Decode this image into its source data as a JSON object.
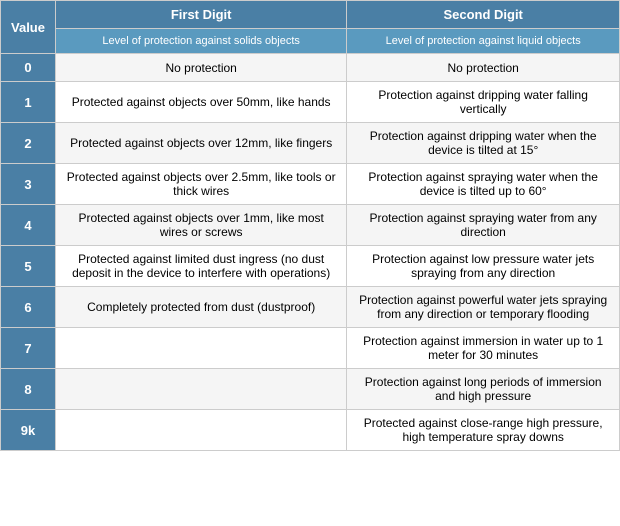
{
  "table": {
    "col1_header": "First Digit",
    "col2_header": "Second Digit",
    "col1_sub": "Level of protection against solids objects",
    "col2_sub": "Level of protection against liquid objects",
    "value_label": "Value",
    "rows": [
      {
        "value": "0",
        "solid": "No protection",
        "liquid": "No protection"
      },
      {
        "value": "1",
        "solid": "Protected against objects over 50mm, like hands",
        "liquid": "Protection against dripping water falling vertically"
      },
      {
        "value": "2",
        "solid": "Protected against objects over 12mm, like fingers",
        "liquid": "Protection against dripping water when the device is tilted at 15°"
      },
      {
        "value": "3",
        "solid": "Protected against objects over 2.5mm, like tools or thick wires",
        "liquid": "Protection against spraying water when the device is tilted up to 60°"
      },
      {
        "value": "4",
        "solid": "Protected against objects over 1mm, like most wires or screws",
        "liquid": "Protection against spraying water from any direction"
      },
      {
        "value": "5",
        "solid": "Protected against limited dust ingress (no dust deposit in the device to interfere with operations)",
        "liquid": "Protection against low pressure water jets spraying from any direction"
      },
      {
        "value": "6",
        "solid": "Completely protected from dust (dustproof)",
        "liquid": "Protection against powerful water jets spraying from any direction or temporary flooding"
      },
      {
        "value": "7",
        "solid": "",
        "liquid": "Protection against immersion in water up to 1 meter for 30 minutes"
      },
      {
        "value": "8",
        "solid": "",
        "liquid": "Protection against long periods of immersion and high pressure"
      },
      {
        "value": "9k",
        "solid": "",
        "liquid": "Protected against close-range high pressure, high temperature spray downs"
      }
    ]
  }
}
